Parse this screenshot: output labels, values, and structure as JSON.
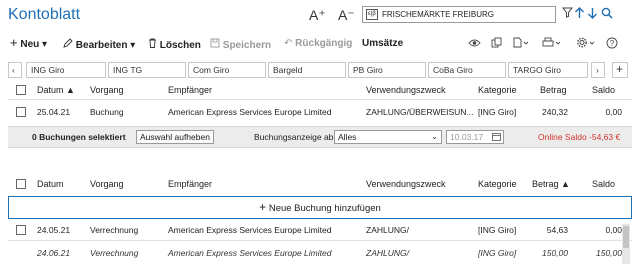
{
  "header": {
    "title": "Kontoblatt",
    "font_increase": "A⁺",
    "font_decrease": "A⁻",
    "account_selector": "FRISCHEMÄRKTE FREIBURG",
    "account_icon_text": "ε|β"
  },
  "toolbar": {
    "new": "Neu",
    "edit": "Bearbeiten",
    "delete": "Löschen",
    "save": "Speichern",
    "undo": "Rückgängig",
    "settle": "Umsätze"
  },
  "account_tabs": [
    "ING Giro",
    "ING TG",
    "Com Giro",
    "Bargeld",
    "PB Giro",
    "CoBa Giro",
    "TARGO Giro"
  ],
  "top_table": {
    "columns": [
      "Datum",
      "Vorgang",
      "Empfänger",
      "Verwendungszweck",
      "Kategorie",
      "Betrag",
      "Saldo"
    ],
    "sort_column_label": "Datum",
    "rows": [
      {
        "datum": "25.04.21",
        "vorgang": "Buchung",
        "empfaenger": "American Express Services Europe Limited",
        "zweck": "ZAHLUNG/ÜBERWEISUN...",
        "kategorie": "[ING Giro]",
        "betrag": "240,32",
        "saldo": "0,00"
      }
    ]
  },
  "selection_bar": {
    "selected_text": "0 Buchungen selektiert",
    "clear_button": "Auswahl aufheben",
    "display_label": "Buchungsanzeige ab",
    "display_value": "Alles",
    "date_value": "10.03.17",
    "online_balance": "Online Saldo -54,63 €"
  },
  "bottom_table": {
    "columns": [
      "Datum",
      "Vorgang",
      "Empfänger",
      "Verwendungszweck",
      "Kategorie",
      "Betrag ▲",
      "Saldo"
    ],
    "new_entry": "Neue Buchung hinzufügen",
    "rows": [
      {
        "datum": "24.05.21",
        "vorgang": "Verrechnung",
        "empfaenger": "American Express Services Europe Limited",
        "zweck": "ZAHLUNG/",
        "kategorie": "[ING Giro]",
        "betrag": "54,63",
        "saldo": "0,00"
      },
      {
        "datum": "24.06.21",
        "vorgang": "Verrechnung",
        "empfaenger": "American Express Services Europe Limited",
        "zweck": "ZAHLUNG/",
        "kategorie": "[ING Giro]",
        "betrag": "150,00",
        "saldo": "150,00"
      }
    ]
  },
  "colors": {
    "accent": "#1f6fb5",
    "negative": "#d0342c"
  }
}
